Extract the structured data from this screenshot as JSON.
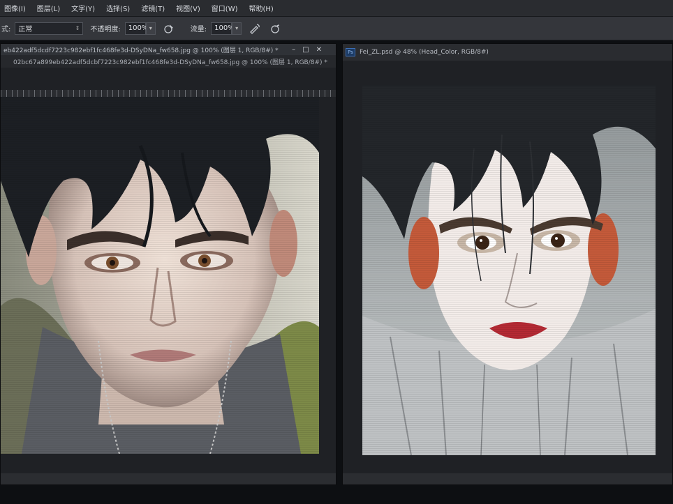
{
  "menu": {
    "items": [
      "图像(I)",
      "图层(L)",
      "文字(Y)",
      "选择(S)",
      "滤镜(T)",
      "视图(V)",
      "窗口(W)",
      "帮助(H)"
    ]
  },
  "options": {
    "mode_label": "式:",
    "mode_value": "正常",
    "opacity_label": "不透明度:",
    "opacity_value": "100%",
    "flow_label": "流量:",
    "flow_value": "100%",
    "icons": [
      "pressure-opacity-icon",
      "airbrush-icon",
      "pressure-size-icon"
    ]
  },
  "doc_left": {
    "title": "eb422adf5dcdf7223c982ebf1fc468fe3d-DSyDNa_fw658.jpg @ 100% (图层 1, RGB/8#) *",
    "tab": "02bc67a899eb422adf5dcbf7223c982ebf1fc468fe3d-DSyDNa_fw658.jpg @ 100% (图层 1, RGB/8#) *",
    "controls": [
      "–",
      "□",
      "✕"
    ]
  },
  "doc_right": {
    "title": "Fei_ZL.psd @ 48% (Head_Color, RGB/8#)",
    "badge": "Ps"
  },
  "colors": {
    "accent": "#3d6fb6",
    "menubar": "#2a2c30",
    "optionsbar": "#34363b",
    "panel": "#1f2125"
  }
}
